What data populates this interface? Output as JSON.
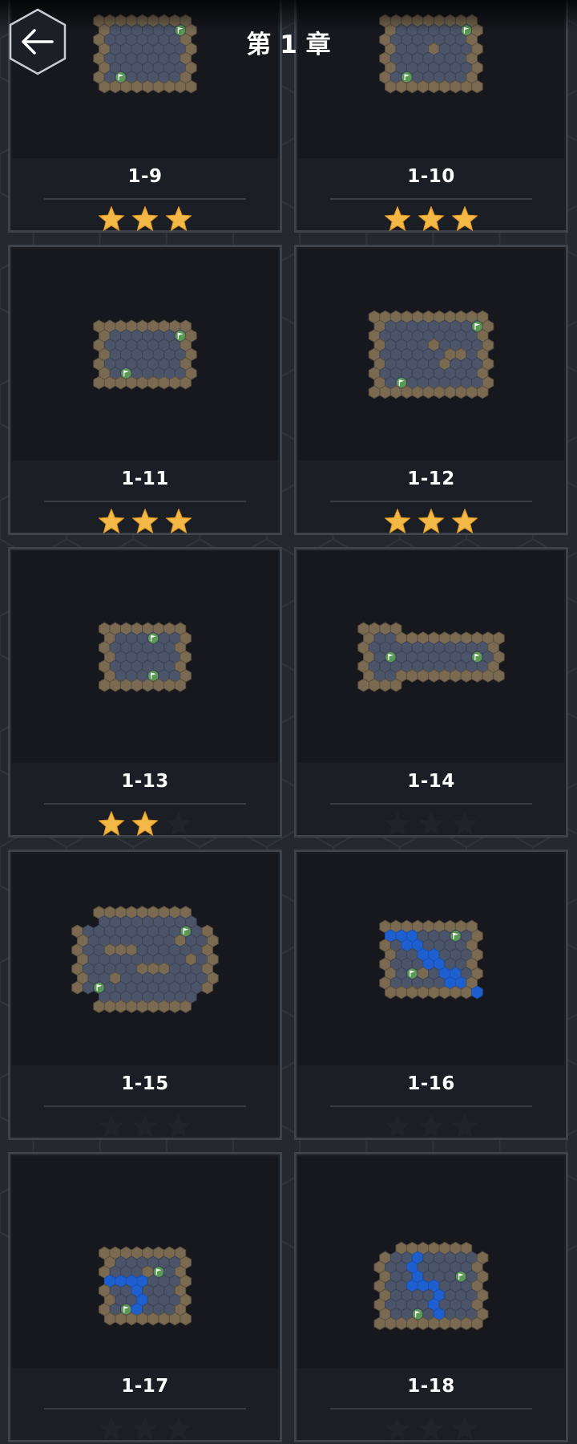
{
  "header": {
    "title": "第 1 章",
    "back_icon": "arrow-left-icon"
  },
  "colors": {
    "background": "#25282e",
    "card_border": "#3d424b",
    "card_bg": "#1b1e24",
    "wall_tile": "#7a6a52",
    "floor_tile": "#4b5468",
    "water_tile": "#1e5fd0",
    "flag_marker": "#5a9a55",
    "star_earned": "#f3b846",
    "star_empty": "#202328"
  },
  "levels": [
    {
      "name": "1-9",
      "stars": 3,
      "shape": "room-small"
    },
    {
      "name": "1-10",
      "stars": 3,
      "shape": "room-small-with-wall"
    },
    {
      "name": "1-11",
      "stars": 3,
      "shape": "room-wide"
    },
    {
      "name": "1-12",
      "stars": 3,
      "shape": "room-large"
    },
    {
      "name": "1-13",
      "stars": 2,
      "shape": "room-narrow"
    },
    {
      "name": "1-14",
      "stars": 0,
      "shape": "dumbbell"
    },
    {
      "name": "1-15",
      "stars": 0,
      "shape": "room-round"
    },
    {
      "name": "1-16",
      "stars": 0,
      "shape": "river-diagonal"
    },
    {
      "name": "1-17",
      "stars": 0,
      "shape": "river-small"
    },
    {
      "name": "1-18",
      "stars": 0,
      "shape": "river-curve"
    }
  ]
}
